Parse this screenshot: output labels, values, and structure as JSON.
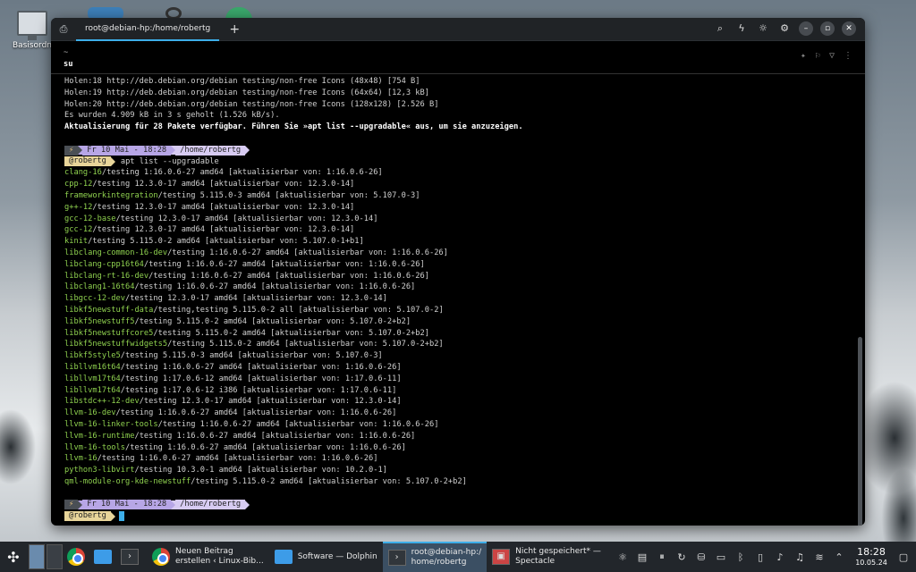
{
  "desktop": {
    "icon_label": "Basisordn"
  },
  "window": {
    "tab_title": "root@debian-hp:/home/robertg",
    "add_tab": "+"
  },
  "terminal": {
    "header_tilde": "~",
    "header_cmd": "su",
    "output_lines": [
      "Holen:18 http://deb.debian.org/debian testing/non-free Icons (48x48) [754 B]",
      "Holen:19 http://deb.debian.org/debian testing/non-free Icons (64x64) [12,3 kB]",
      "Holen:20 http://deb.debian.org/debian testing/non-free Icons (128x128) [2.526 B]",
      "Es wurden 4.909 kB in 3 s geholt (1.526 kB/s)."
    ],
    "bold_line": "Aktualisierung für 28 Pakete verfügbar. Führen Sie »apt list --upgradable« aus, um sie anzuzeigen.",
    "prompt": {
      "bolt": "⚡",
      "date": "Fr 10 Mai - 18:28",
      "dir": "/home/robertg",
      "user": "@robertg"
    },
    "command": "apt list --upgradable",
    "packages": [
      {
        "name": "clang-16",
        "rest": "/testing 1:16.0.6-27 amd64 [aktualisierbar von: 1:16.0.6-26]"
      },
      {
        "name": "cpp-12",
        "rest": "/testing 12.3.0-17 amd64 [aktualisierbar von: 12.3.0-14]"
      },
      {
        "name": "frameworkintegration",
        "rest": "/testing 5.115.0-3 amd64 [aktualisierbar von: 5.107.0-3]"
      },
      {
        "name": "g++-12",
        "rest": "/testing 12.3.0-17 amd64 [aktualisierbar von: 12.3.0-14]"
      },
      {
        "name": "gcc-12-base",
        "rest": "/testing 12.3.0-17 amd64 [aktualisierbar von: 12.3.0-14]"
      },
      {
        "name": "gcc-12",
        "rest": "/testing 12.3.0-17 amd64 [aktualisierbar von: 12.3.0-14]"
      },
      {
        "name": "kinit",
        "rest": "/testing 5.115.0-2 amd64 [aktualisierbar von: 5.107.0-1+b1]"
      },
      {
        "name": "libclang-common-16-dev",
        "rest": "/testing 1:16.0.6-27 amd64 [aktualisierbar von: 1:16.0.6-26]"
      },
      {
        "name": "libclang-cpp16t64",
        "rest": "/testing 1:16.0.6-27 amd64 [aktualisierbar von: 1:16.0.6-26]"
      },
      {
        "name": "libclang-rt-16-dev",
        "rest": "/testing 1:16.0.6-27 amd64 [aktualisierbar von: 1:16.0.6-26]"
      },
      {
        "name": "libclang1-16t64",
        "rest": "/testing 1:16.0.6-27 amd64 [aktualisierbar von: 1:16.0.6-26]"
      },
      {
        "name": "libgcc-12-dev",
        "rest": "/testing 12.3.0-17 amd64 [aktualisierbar von: 12.3.0-14]"
      },
      {
        "name": "libkf5newstuff-data",
        "rest": "/testing,testing 5.115.0-2 all [aktualisierbar von: 5.107.0-2]"
      },
      {
        "name": "libkf5newstuff5",
        "rest": "/testing 5.115.0-2 amd64 [aktualisierbar von: 5.107.0-2+b2]"
      },
      {
        "name": "libkf5newstuffcore5",
        "rest": "/testing 5.115.0-2 amd64 [aktualisierbar von: 5.107.0-2+b2]"
      },
      {
        "name": "libkf5newstuffwidgets5",
        "rest": "/testing 5.115.0-2 amd64 [aktualisierbar von: 5.107.0-2+b2]"
      },
      {
        "name": "libkf5style5",
        "rest": "/testing 5.115.0-3 amd64 [aktualisierbar von: 5.107.0-3]"
      },
      {
        "name": "libllvm16t64",
        "rest": "/testing 1:16.0.6-27 amd64 [aktualisierbar von: 1:16.0.6-26]"
      },
      {
        "name": "libllvm17t64",
        "rest": "/testing 1:17.0.6-12 amd64 [aktualisierbar von: 1:17.0.6-11]"
      },
      {
        "name": "libllvm17t64",
        "rest": "/testing 1:17.0.6-12 i386 [aktualisierbar von: 1:17.0.6-11]"
      },
      {
        "name": "libstdc++-12-dev",
        "rest": "/testing 12.3.0-17 amd64 [aktualisierbar von: 12.3.0-14]"
      },
      {
        "name": "llvm-16-dev",
        "rest": "/testing 1:16.0.6-27 amd64 [aktualisierbar von: 1:16.0.6-26]"
      },
      {
        "name": "llvm-16-linker-tools",
        "rest": "/testing 1:16.0.6-27 amd64 [aktualisierbar von: 1:16.0.6-26]"
      },
      {
        "name": "llvm-16-runtime",
        "rest": "/testing 1:16.0.6-27 amd64 [aktualisierbar von: 1:16.0.6-26]"
      },
      {
        "name": "llvm-16-tools",
        "rest": "/testing 1:16.0.6-27 amd64 [aktualisierbar von: 1:16.0.6-26]"
      },
      {
        "name": "llvm-16",
        "rest": "/testing 1:16.0.6-27 amd64 [aktualisierbar von: 1:16.0.6-26]"
      },
      {
        "name": "python3-libvirt",
        "rest": "/testing 10.3.0-1 amd64 [aktualisierbar von: 10.2.0-1]"
      },
      {
        "name": "qml-module-org-kde-newstuff",
        "rest": "/testing 5.115.0-2 amd64 [aktualisierbar von: 5.107.0-2+b2]"
      }
    ]
  },
  "taskbar": {
    "tasks": [
      {
        "label1": "Neuen Beitrag",
        "label2": "erstellen ‹ Linux-Bib..."
      },
      {
        "label1": "Software — Dolphin",
        "label2": ""
      },
      {
        "label1": "root@debian-hp:/",
        "label2": "home/robertg"
      },
      {
        "label1": "Nicht gespeichert* —",
        "label2": "Spectacle"
      }
    ],
    "clock_time": "18:28",
    "clock_date": "10.05.24"
  }
}
